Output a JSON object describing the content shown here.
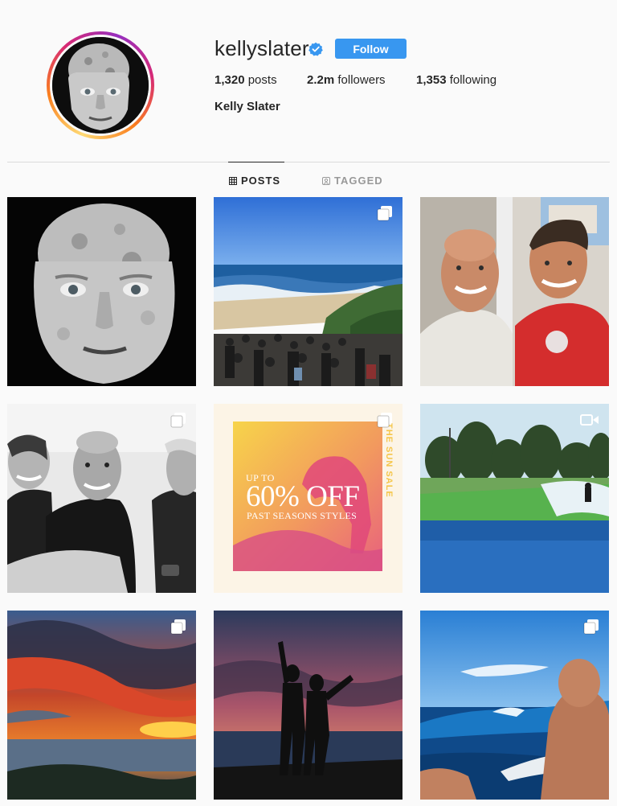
{
  "profile": {
    "username": "kellyslater",
    "verified": true,
    "follow_label": "Follow",
    "full_name": "Kelly Slater",
    "stats": {
      "posts_count": "1,320",
      "posts_label": "posts",
      "followers_count": "2.2m",
      "followers_label": "followers",
      "following_count": "1,353",
      "following_label": "following"
    }
  },
  "tabs": [
    {
      "label": "POSTS",
      "active": true,
      "icon": "grid-icon"
    },
    {
      "label": "TAGGED",
      "active": false,
      "icon": "tag-icon"
    }
  ],
  "colors": {
    "accent": "#3897f0",
    "text": "#262626",
    "muted": "#999999",
    "background": "#fafafa",
    "divider": "#dbdbdb"
  },
  "posts": [
    {
      "badge": "none"
    },
    {
      "badge": "carousel-icon"
    },
    {
      "badge": "none"
    },
    {
      "badge": "carousel-icon"
    },
    {
      "badge": "carousel-icon",
      "sale": {
        "line1": "UP TO",
        "line2": "60% OFF",
        "line3": "PAST SEASONS STYLES",
        "vertical": "THE SUN SALE"
      }
    },
    {
      "badge": "video-icon"
    },
    {
      "badge": "carousel-icon"
    },
    {
      "badge": "none"
    },
    {
      "badge": "carousel-icon"
    }
  ]
}
